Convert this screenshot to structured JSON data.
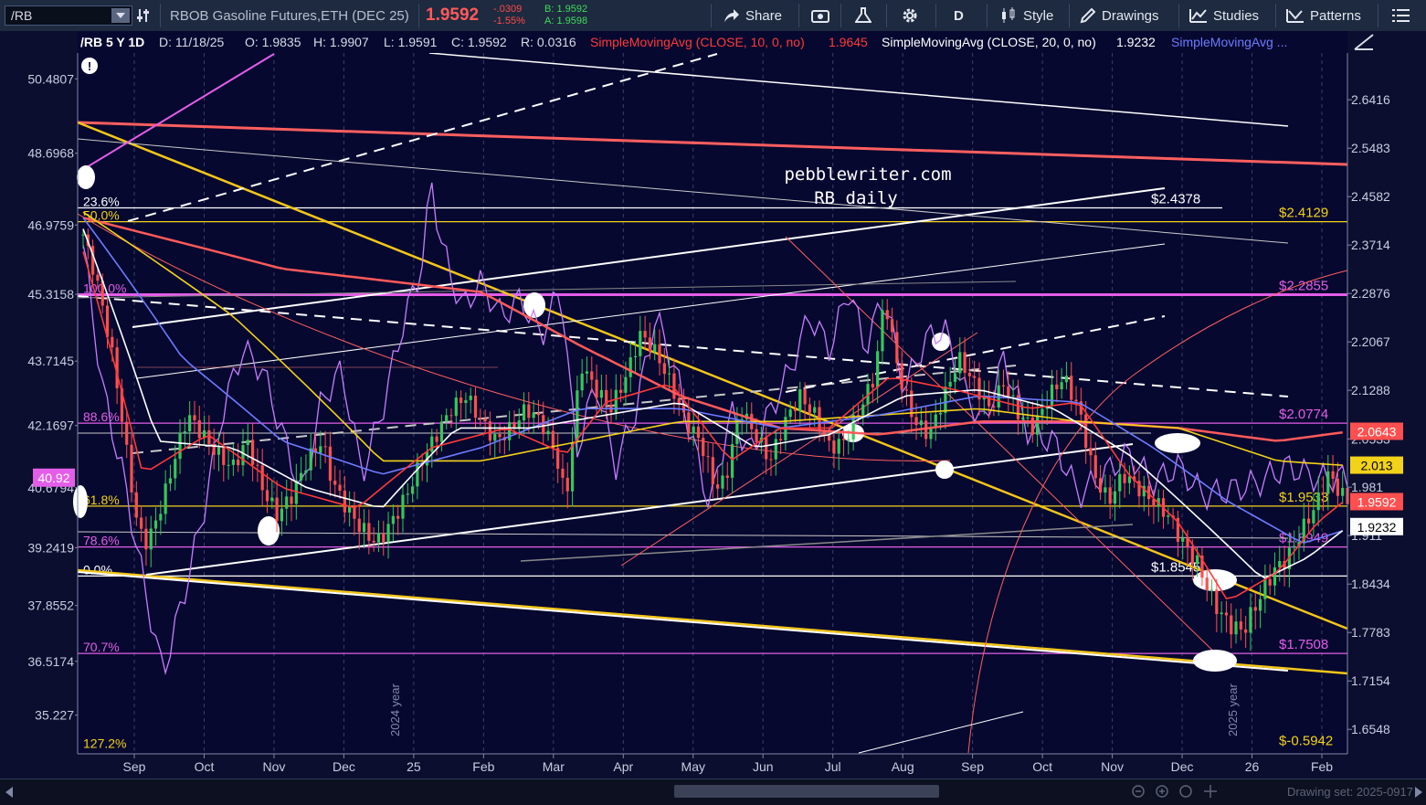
{
  "toolbar": {
    "symbol": "/RB",
    "description": "RBOB Gasoline Futures,ETH (DEC 25)",
    "last": "1.9592",
    "change": "-.0309",
    "change_pct": "-1.55%",
    "bid": "B: 1.9592",
    "ask": "A: 1.9598",
    "share_label": "Share",
    "interval_label": "D",
    "style_label": "Style",
    "drawings_label": "Drawings",
    "studies_label": "Studies",
    "patterns_label": "Patterns",
    "colors": {
      "price": "#ff5a5a",
      "change": "#ff4a4a",
      "bidask": "#3fdc5a"
    }
  },
  "header": {
    "chart_id": "/RB 5 Y 1D",
    "date": "D: 11/18/25",
    "open": "O: 1.9835",
    "high": "H: 1.9907",
    "low": "L: 1.9591",
    "close": "C: 1.9592",
    "range": "R: 0.0316",
    "sma10_label": "SimpleMovingAvg (CLOSE, 10, 0, no)",
    "sma10_value": "1.9645",
    "sma20_label": "SimpleMovingAvg (CLOSE, 20, 0, no)",
    "sma20_value": "1.9232",
    "sma_more_label": "SimpleMovingAvg ..."
  },
  "annotation": {
    "line1": "pebblewriter.com",
    "line2": "RB daily"
  },
  "chart_data": {
    "type": "line",
    "x_labels": [
      "Sep",
      "Oct",
      "Nov",
      "Dec",
      "25",
      "Feb",
      "Mar",
      "Apr",
      "May",
      "Jun",
      "Jul",
      "Aug",
      "Sep",
      "Oct",
      "Nov",
      "Dec",
      "26",
      "Feb"
    ],
    "left_axis": {
      "ticks": [
        "50.4807",
        "48.6968",
        "46.9759",
        "45.3158",
        "43.7145",
        "42.1697",
        "40.6794",
        "39.2419",
        "37.8552",
        "36.5174",
        "35.227"
      ],
      "current": "40.92",
      "ylim": [
        34.3,
        51.1
      ]
    },
    "right_axis": {
      "ticks": [
        "2.6416",
        "2.5483",
        "2.4582",
        "2.3714",
        "2.2876",
        "2.2067",
        "2.1288",
        "2.0533",
        "1.981",
        "1.911",
        "1.8434",
        "1.7783",
        "1.7154",
        "1.6548"
      ],
      "ylim": [
        1.625,
        2.735
      ],
      "scale": "log",
      "badges": [
        {
          "label": "2.0643",
          "value": 2.0643,
          "bg": "#ff4f4f",
          "fg": "#ffffff"
        },
        {
          "label": "2.013",
          "value": 2.013,
          "bg": "#f3d21a",
          "fg": "#000000"
        },
        {
          "label": "1.9592",
          "value": 1.9592,
          "bg": "#ff4f4f",
          "fg": "#ffffff"
        },
        {
          "label": "1.9232",
          "value": 1.9232,
          "bg": "#ffffff",
          "fg": "#000000"
        }
      ]
    },
    "fib_levels": [
      {
        "pct": "23.6%",
        "value": 2.4378,
        "label": "$2.4378",
        "color": "#ffffff"
      },
      {
        "pct": "50.0%",
        "value": 2.4129,
        "label": "$2.4129",
        "color": "#f3d21a"
      },
      {
        "pct": "100.0%",
        "value": 2.2855,
        "label": "$2.2855",
        "color": "#e45de8"
      },
      {
        "pct": "88.6%",
        "value": 2.0774,
        "label": "$2.0774",
        "color": "#e45de8"
      },
      {
        "pct": "61.8%",
        "value": 1.9533,
        "label": "$1.9533",
        "color": "#f3d21a"
      },
      {
        "pct": "78.6%",
        "value": 1.8949,
        "label": "$1.8949",
        "color": "#e45de8"
      },
      {
        "pct": "0.0%",
        "value": 1.8545,
        "label": "$1.8545",
        "color": "#ffffff"
      },
      {
        "pct": "70.7%",
        "value": 1.7508,
        "label": "$1.7508",
        "color": "#e45de8"
      },
      {
        "pct": "127.2%",
        "value": 1.63,
        "label": "$-0.5942",
        "color": "#f3d21a"
      }
    ],
    "year_labels": [
      "2024 year",
      "2025 year"
    ],
    "price_series": {
      "name": "/RB close",
      "points": [
        [
          0,
          2.39
        ],
        [
          3,
          2.3
        ],
        [
          6,
          2.18
        ],
        [
          9,
          2.02
        ],
        [
          11,
          1.92
        ],
        [
          13,
          1.9
        ],
        [
          16,
          1.96
        ],
        [
          19,
          2.04
        ],
        [
          21,
          2.09
        ],
        [
          24,
          2.06
        ],
        [
          27,
          2.03
        ],
        [
          30,
          2.01
        ],
        [
          33,
          2.05
        ],
        [
          36,
          1.98
        ],
        [
          39,
          1.94
        ],
        [
          42,
          1.97
        ],
        [
          45,
          2.02
        ],
        [
          48,
          2.05
        ],
        [
          50,
          1.99
        ],
        [
          53,
          1.95
        ],
        [
          56,
          1.92
        ],
        [
          59,
          1.9
        ],
        [
          62,
          1.93
        ],
        [
          65,
          1.97
        ],
        [
          68,
          2.02
        ],
        [
          71,
          2.06
        ],
        [
          74,
          2.1
        ],
        [
          77,
          2.12
        ],
        [
          80,
          2.08
        ],
        [
          83,
          2.05
        ],
        [
          86,
          2.07
        ],
        [
          89,
          2.1
        ],
        [
          92,
          2.08
        ],
        [
          95,
          2.03
        ],
        [
          97,
          1.96
        ],
        [
          100,
          2.17
        ],
        [
          103,
          2.13
        ],
        [
          106,
          2.1
        ],
        [
          109,
          2.15
        ],
        [
          112,
          2.22
        ],
        [
          115,
          2.19
        ],
        [
          118,
          2.14
        ],
        [
          121,
          2.08
        ],
        [
          124,
          2.05
        ],
        [
          127,
          1.98
        ],
        [
          129,
          1.99
        ],
        [
          132,
          2.1
        ],
        [
          135,
          2.06
        ],
        [
          138,
          2.02
        ],
        [
          141,
          2.08
        ],
        [
          144,
          2.12
        ],
        [
          147,
          2.09
        ],
        [
          150,
          2.04
        ],
        [
          153,
          2.05
        ],
        [
          156,
          2.1
        ],
        [
          159,
          2.15
        ],
        [
          161,
          2.28
        ],
        [
          164,
          2.15
        ],
        [
          167,
          2.08
        ],
        [
          170,
          2.06
        ],
        [
          173,
          2.12
        ],
        [
          176,
          2.18
        ],
        [
          179,
          2.14
        ],
        [
          182,
          2.1
        ],
        [
          185,
          2.14
        ],
        [
          188,
          2.09
        ],
        [
          191,
          2.07
        ],
        [
          194,
          2.12
        ],
        [
          197,
          2.15
        ],
        [
          200,
          2.1
        ],
        [
          203,
          2.0
        ],
        [
          206,
          1.96
        ],
        [
          209,
          2.0
        ],
        [
          212,
          1.98
        ],
        [
          215,
          1.96
        ],
        [
          218,
          1.94
        ],
        [
          221,
          1.9
        ],
        [
          224,
          1.87
        ],
        [
          227,
          1.82
        ],
        [
          230,
          1.79
        ],
        [
          233,
          1.78
        ],
        [
          236,
          1.82
        ],
        [
          239,
          1.86
        ],
        [
          242,
          1.88
        ],
        [
          245,
          1.92
        ],
        [
          248,
          1.96
        ],
        [
          250,
          2.0
        ],
        [
          252,
          1.98
        ],
        [
          254,
          1.9592
        ]
      ]
    },
    "sma10": {
      "name": "SimpleMovingAvg (CLOSE, 10, 0, no)",
      "color": "#ff3a3a",
      "points": [
        [
          0,
          2.36
        ],
        [
          12,
          2.0
        ],
        [
          25,
          2.06
        ],
        [
          40,
          1.98
        ],
        [
          55,
          1.95
        ],
        [
          70,
          2.04
        ],
        [
          85,
          2.07
        ],
        [
          97,
          2.03
        ],
        [
          105,
          2.11
        ],
        [
          118,
          2.14
        ],
        [
          130,
          2.02
        ],
        [
          140,
          2.07
        ],
        [
          150,
          2.07
        ],
        [
          162,
          2.15
        ],
        [
          175,
          2.13
        ],
        [
          190,
          2.1
        ],
        [
          200,
          2.11
        ],
        [
          210,
          2.0
        ],
        [
          220,
          1.93
        ],
        [
          230,
          1.82
        ],
        [
          240,
          1.86
        ],
        [
          248,
          1.93
        ],
        [
          254,
          1.9645
        ]
      ]
    },
    "sma20": {
      "name": "SimpleMovingAvg (CLOSE, 20, 0, no)",
      "color": "#ffffff",
      "points": [
        [
          0,
          2.4
        ],
        [
          15,
          2.05
        ],
        [
          30,
          2.04
        ],
        [
          45,
          1.98
        ],
        [
          60,
          1.95
        ],
        [
          75,
          2.07
        ],
        [
          90,
          2.07
        ],
        [
          105,
          2.09
        ],
        [
          120,
          2.11
        ],
        [
          135,
          2.04
        ],
        [
          150,
          2.06
        ],
        [
          165,
          2.12
        ],
        [
          180,
          2.13
        ],
        [
          195,
          2.1
        ],
        [
          210,
          2.03
        ],
        [
          225,
          1.93
        ],
        [
          237,
          1.85
        ],
        [
          246,
          1.88
        ],
        [
          254,
          1.9232
        ]
      ]
    },
    "sma50": {
      "name": "SimpleMovingAvg ...",
      "color": "#6d7bff",
      "points": [
        [
          0,
          2.42
        ],
        [
          20,
          2.18
        ],
        [
          40,
          2.05
        ],
        [
          60,
          2.0
        ],
        [
          80,
          2.04
        ],
        [
          100,
          2.1
        ],
        [
          120,
          2.1
        ],
        [
          140,
          2.07
        ],
        [
          160,
          2.09
        ],
        [
          180,
          2.12
        ],
        [
          200,
          2.11
        ],
        [
          215,
          2.04
        ],
        [
          230,
          1.96
        ],
        [
          245,
          1.9
        ],
        [
          254,
          1.92
        ]
      ]
    },
    "sma100": {
      "color": "#f3d21a",
      "points": [
        [
          0,
          2.43
        ],
        [
          30,
          2.25
        ],
        [
          60,
          2.02
        ],
        [
          80,
          2.02
        ],
        [
          100,
          2.05
        ],
        [
          120,
          2.08
        ],
        [
          140,
          2.08
        ],
        [
          160,
          2.09
        ],
        [
          180,
          2.1
        ],
        [
          200,
          2.08
        ],
        [
          220,
          2.07
        ],
        [
          240,
          2.02
        ],
        [
          254,
          2.013
        ]
      ]
    },
    "sma200": {
      "color": "#ff5a5a",
      "points": [
        [
          0,
          2.42
        ],
        [
          40,
          2.33
        ],
        [
          80,
          2.29
        ],
        [
          100,
          2.2
        ],
        [
          120,
          2.12
        ],
        [
          140,
          2.07
        ],
        [
          160,
          2.06
        ],
        [
          180,
          2.08
        ],
        [
          200,
          2.08
        ],
        [
          220,
          2.07
        ],
        [
          240,
          2.05
        ],
        [
          254,
          2.0643
        ]
      ]
    },
    "oscillator": {
      "name": "ratio (left axis)",
      "color": "#c77dff",
      "points": [
        [
          0,
          46.5
        ],
        [
          4,
          43.0
        ],
        [
          8,
          41.0
        ],
        [
          12,
          38.5
        ],
        [
          16,
          36.2
        ],
        [
          20,
          38.0
        ],
        [
          24,
          40.0
        ],
        [
          28,
          42.5
        ],
        [
          32,
          44.0
        ],
        [
          36,
          43.5
        ],
        [
          40,
          42.0
        ],
        [
          44,
          40.5
        ],
        [
          48,
          42.8
        ],
        [
          52,
          43.5
        ],
        [
          56,
          41.0
        ],
        [
          60,
          42.5
        ],
        [
          64,
          44.5
        ],
        [
          68,
          46.0
        ],
        [
          70,
          48.0
        ],
        [
          72,
          46.5
        ],
        [
          76,
          45.0
        ],
        [
          80,
          45.6
        ],
        [
          84,
          44.8
        ],
        [
          88,
          45.2
        ],
        [
          92,
          44.3
        ],
        [
          96,
          45.5
        ],
        [
          99,
          41.5
        ],
        [
          103,
          43.2
        ],
        [
          107,
          41.2
        ],
        [
          111,
          42.5
        ],
        [
          115,
          44.8
        ],
        [
          119,
          43.5
        ],
        [
          122,
          42.0
        ],
        [
          126,
          40.2
        ],
        [
          130,
          42.5
        ],
        [
          134,
          41.5
        ],
        [
          138,
          42.5
        ],
        [
          142,
          43.5
        ],
        [
          146,
          44.8
        ],
        [
          150,
          44.0
        ],
        [
          154,
          45.5
        ],
        [
          157,
          44.0
        ],
        [
          161,
          45.3
        ],
        [
          165,
          43.0
        ],
        [
          169,
          44.2
        ],
        [
          173,
          44.5
        ],
        [
          177,
          43.0
        ],
        [
          181,
          42.2
        ],
        [
          185,
          43.8
        ],
        [
          190,
          42.0
        ],
        [
          195,
          41.8
        ],
        [
          200,
          40.5
        ],
        [
          205,
          41.0
        ],
        [
          210,
          41.5
        ],
        [
          215,
          40.8
        ],
        [
          220,
          41.2
        ],
        [
          225,
          40.5
        ],
        [
          230,
          40.6
        ],
        [
          236,
          40.8
        ],
        [
          242,
          41.2
        ],
        [
          248,
          40.9
        ],
        [
          254,
          40.92
        ]
      ]
    },
    "n_bars": 262,
    "grid": true
  }
}
